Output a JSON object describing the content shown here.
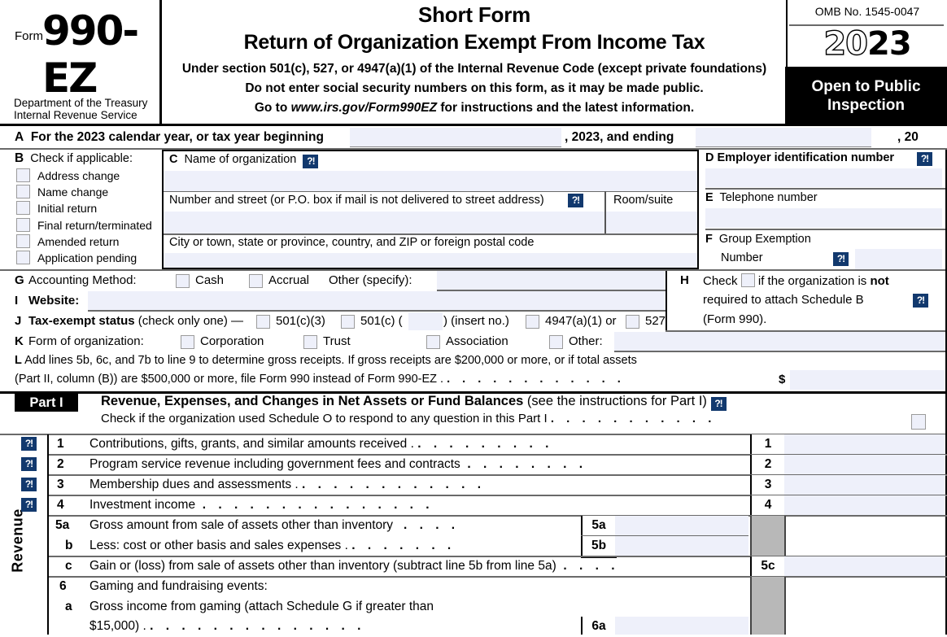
{
  "header": {
    "form_word": "Form",
    "form_number": "990-EZ",
    "department_line1": "Department of the Treasury",
    "department_line2": "Internal Revenue Service",
    "title_short": "Short Form",
    "title_main": "Return of Organization Exempt From Income Tax",
    "subtitle_1": "Under section 501(c), 527, or 4947(a)(1) of the Internal Revenue Code (except private foundations)",
    "subtitle_2": "Do not enter social security numbers on this form, as it may be made public.",
    "subtitle_3_pre": "Go to ",
    "subtitle_3_url": "www.irs.gov/Form990EZ",
    "subtitle_3_post": " for instructions and the latest information.",
    "omb": "OMB No. 1545-0047",
    "year_light": "20",
    "year_bold": "23",
    "open_to_public_line1": "Open to Public",
    "open_to_public_line2": "Inspection"
  },
  "rowA": {
    "letter": "A",
    "text": "For the 2023 calendar year, or tax year beginning",
    "mid_text": ", 2023, and ending",
    "end_text": ", 20"
  },
  "blockB": {
    "letter": "B",
    "caption": "Check if applicable:",
    "checkboxes": [
      "Address change",
      "Name change",
      "Initial return",
      "Final return/terminated",
      "Amended return",
      "Application pending"
    ]
  },
  "blockC": {
    "letter": "C",
    "name_label": "Name of organization",
    "street_label": "Number and street (or P.O. box if mail is not delivered to street address)",
    "room_label": "Room/suite",
    "city_label": "City or town, state or province, country, and ZIP or foreign postal code",
    "help_icon": "?!"
  },
  "blockD": {
    "letter": "D",
    "label": "Employer identification number",
    "help_icon": "?!"
  },
  "blockE": {
    "letter": "E",
    "label": "Telephone number"
  },
  "blockF": {
    "letter": "F",
    "label_line1": "Group Exemption",
    "label_line2": "Number",
    "help_icon": "?!"
  },
  "rowG": {
    "letter": "G",
    "label": "Accounting Method:",
    "option_cash": "Cash",
    "option_accrual": "Accrual",
    "option_other": "Other (specify):"
  },
  "rowI": {
    "letter": "I",
    "label": "Website:"
  },
  "rowJ": {
    "letter": "J",
    "label_bold": "Tax-exempt status",
    "label_rest": "(check only one) —",
    "opt_501c3": "501(c)(3)",
    "opt_501c_pre": "501(c) (",
    "opt_501c_post": ") (insert no.)",
    "opt_4947": "4947(a)(1) or",
    "opt_527": "527"
  },
  "rowK": {
    "letter": "K",
    "label": "Form of organization:",
    "opt_corporation": "Corporation",
    "opt_trust": "Trust",
    "opt_association": "Association",
    "opt_other": "Other:"
  },
  "blockH": {
    "letter": "H",
    "line1_pre": "Check",
    "line1_post_a": "if the organization is ",
    "line1_post_b": "not",
    "line2": "required to attach Schedule B",
    "line3": "(Form 990).",
    "help_icon": "?!"
  },
  "rowL": {
    "letter": "L",
    "line1": "Add lines 5b, 6c, and 7b to line 9 to determine gross receipts. If gross receipts are $200,000 or more, or if total assets",
    "line2": "(Part II, column (B)) are $500,000 or more, file Form 990 instead of Form 990-EZ .",
    "dots": ".  .  .  .  .  .  .  .  .  .  .  .",
    "dollar": "$"
  },
  "partI": {
    "label": "Part I",
    "title_bold": "Revenue, Expenses, and Changes in Net Assets or Fund Balances",
    "title_rest": "(see the instructions for Part I)",
    "help_icon": "?!",
    "schedule_o": "Check if the organization used Schedule O to respond to any question in this Part I",
    "schedule_o_dots": ".  .  .  .  .  .  .  .  .  .  .",
    "side_label": "Revenue"
  },
  "lines": [
    {
      "num": "1",
      "desc": "Contributions, gifts, grants, and similar amounts received .",
      "dots": ".   .   .   .   .   .   .   .   .",
      "cell": "1",
      "help": "?!",
      "value": ""
    },
    {
      "num": "2",
      "desc": "Program service revenue including government fees and contracts",
      "dots": ".   .   .   .   .   .   .   .",
      "cell": "2",
      "help": "?!",
      "value": ""
    },
    {
      "num": "3",
      "desc": "Membership dues and assessments .",
      "dots": ".   .   .   .   .   .   .   .   .   .   .   .",
      "cell": "3",
      "help": "?!",
      "value": ""
    },
    {
      "num": "4",
      "desc": "Investment income",
      "dots": ".   .   .   .   .   .   .   .   .   .   .   .   .   .   .",
      "cell": "4",
      "help": "?!",
      "value": ""
    },
    {
      "num": "5a",
      "desc": "Gross amount from sale of assets other than inventory",
      "dots": ".   .   .   .",
      "cell": "5a",
      "help": "",
      "value": ""
    },
    {
      "num": "b",
      "desc": "Less: cost or other basis and sales expenses .",
      "dots": ".   .   .   .   .   .   .",
      "cell": "5b",
      "help": "",
      "value": ""
    },
    {
      "num": "c",
      "desc": "Gain or (loss) from sale of assets other than inventory (subtract line 5b from line 5a)",
      "dots": ".   .   .   .",
      "cell": "5c",
      "help": "",
      "value": ""
    },
    {
      "num": "6",
      "desc": "Gaming and fundraising events:",
      "dots": "",
      "cell": "",
      "help": "",
      "value": ""
    },
    {
      "num": "a",
      "desc": "Gross   income   from   gaming   (attach   Schedule   G   if   greater   than",
      "dots": "",
      "cell": "",
      "help": "",
      "value": ""
    },
    {
      "num": "",
      "desc": "$15,000) .",
      "dots": ".   .   .   .   .   .   .   .   .   .   .   .   .   .",
      "cell": "6a",
      "help": "",
      "value": ""
    }
  ]
}
